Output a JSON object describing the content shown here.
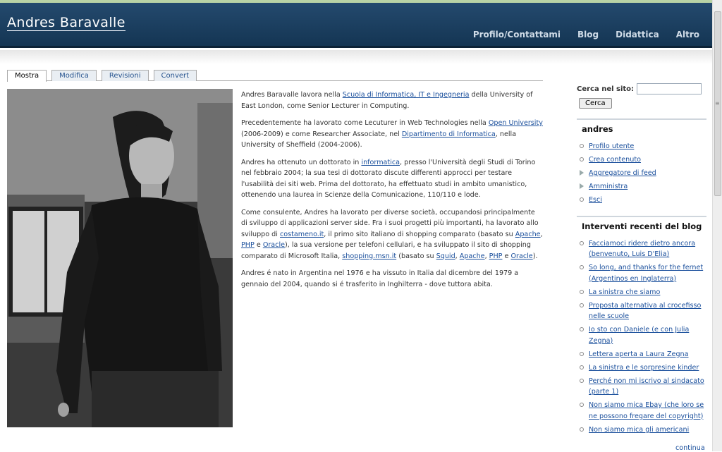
{
  "site": {
    "title": "Andres Baravalle",
    "nav": [
      "Profilo/Contattami",
      "Blog",
      "Didattica",
      "Altro"
    ]
  },
  "tabs": [
    "Mostra",
    "Modifica",
    "Revisioni",
    "Convert"
  ],
  "article": {
    "p1": {
      "t1": "Andres Baravalle lavora nella ",
      "link1": "Scuola di Informatica, IT e Ingegneria",
      "t2": " della University of East London, come Senior Lecturer in Computing."
    },
    "p2": {
      "t1": "Precedentemente ha lavorato come Lecuturer in Web Technologies nella ",
      "link1": "Open University",
      "t2": " (2006-2009) e come Researcher Associate, nel ",
      "link2": "Dipartimento di Informatica",
      "t3": ", nella University of Sheffield (2004-2006)."
    },
    "p3": {
      "t1": "Andres ha ottenuto un dottorato in ",
      "link1": "informatica",
      "t2": ", presso l'Università degli Studi di Torino nel febbraio 2004; la sua tesi di dottorato discute differenti approcci per testare l'usabilità dei siti web. Prima del dottorato, ha effettuato studi in ambito umanistico, ottenendo una laurea in Scienze della Comunicazione, 110/110 e lode."
    },
    "p4": {
      "t1": "Come consulente, Andres ha lavorato per diverse società, occupandosi principalmente di sviluppo di applicazioni server side. Fra i suoi progetti più importanti, ha lavorato allo sviluppo di ",
      "link1": "costameno.it",
      "t2": ", il primo sito italiano di shopping comparato (basato su ",
      "link2": "Apache",
      "t3": ", ",
      "link3": "PHP",
      "t4": " e ",
      "link4": "Oracle",
      "t5": "), la sua versione per telefoni cellulari, e ha sviluppato il sito di shopping comparato di Microsoft Italia, ",
      "link5": "shopping.msn.it",
      "t6": " (basato su ",
      "link6": "Squid",
      "t7": ", ",
      "link7": "Apache",
      "t8": ", ",
      "link8": "PHP",
      "t9": " e ",
      "link9": "Oracle",
      "t10": ")."
    },
    "p5": "Andres é nato in Argentina nel 1976 e ha vissuto in Italia dal dicembre del 1979 a gennaio del 2004, quando si é trasferito in Inghilterra - dove tuttora abita."
  },
  "sidebar": {
    "search_label": "Cerca nel sito:",
    "search_value": "",
    "search_button": "Cerca",
    "user_block_title": "andres",
    "user_links": [
      "Profilo utente",
      "Crea contenuto",
      "Aggregatore di feed",
      "Amministra",
      "Esci"
    ],
    "blog_block_title": "Interventi recenti del blog",
    "blog_links": [
      "Facciamoci ridere dietro ancora (benvenuto, Luis D'Elia)",
      "So long, and thanks for the fernet (Argentinos en Inglaterra)",
      "La sinistra che siamo",
      "Proposta alternativa al crocefisso nelle scuole",
      "Io sto con Daniele (e con Julia Zegna)",
      "Lettera aperta a Laura Zegna",
      "La sinistra e le sorpresine kinder",
      "Perché non mi iscrivo al sindacato (parte 1)",
      "Non siamo mica Ebay (che loro se ne possono fregare del copyright)",
      "Non siamo mica gli americani"
    ],
    "more_link": "continua"
  }
}
